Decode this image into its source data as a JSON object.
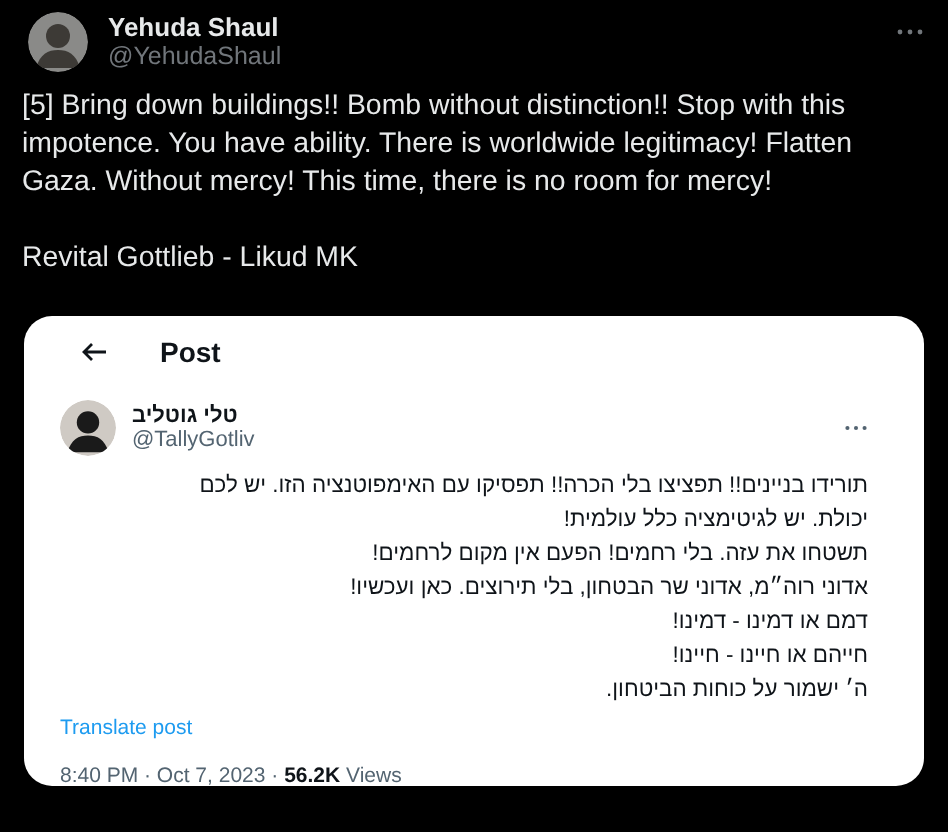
{
  "author": {
    "name": "Yehuda Shaul",
    "handle": "@YehudaShaul"
  },
  "body": [
    "[5] Bring down buildings!! Bomb without distinction!! Stop with this impotence. You have ability. There is worldwide legitimacy! Flatten Gaza. Without mercy! This time, there is no room for mercy!",
    "Revital Gottlieb - Likud MK"
  ],
  "embedded_screenshot": {
    "header_title": "Post",
    "author": {
      "name": "טלי גוטליב",
      "handle": "@TallyGotliv"
    },
    "lines": [
      "תורידו בניינים!! תפציצו בלי הכרה!! תפסיקו עם האימפוטנציה הזו. יש לכם יכולת. יש לגיטימציה כלל עולמית!",
      "תשטחו את עזה. בלי רחמים! הפעם אין מקום לרחמים!",
      "אדוני רוה״מ, אדוני שר הבטחון, בלי תירוצים. כאן ועכשיו!",
      "דמם או דמינו - דמינו!",
      "חייהם או חיינו - חיינו!",
      "ה׳ ישמור על כוחות הביטחון."
    ],
    "translate_link": "Translate post",
    "timestamp": "8:40 PM · Oct 7, 2023 · ",
    "views_count": "56.2K",
    "views_label": " Views"
  }
}
